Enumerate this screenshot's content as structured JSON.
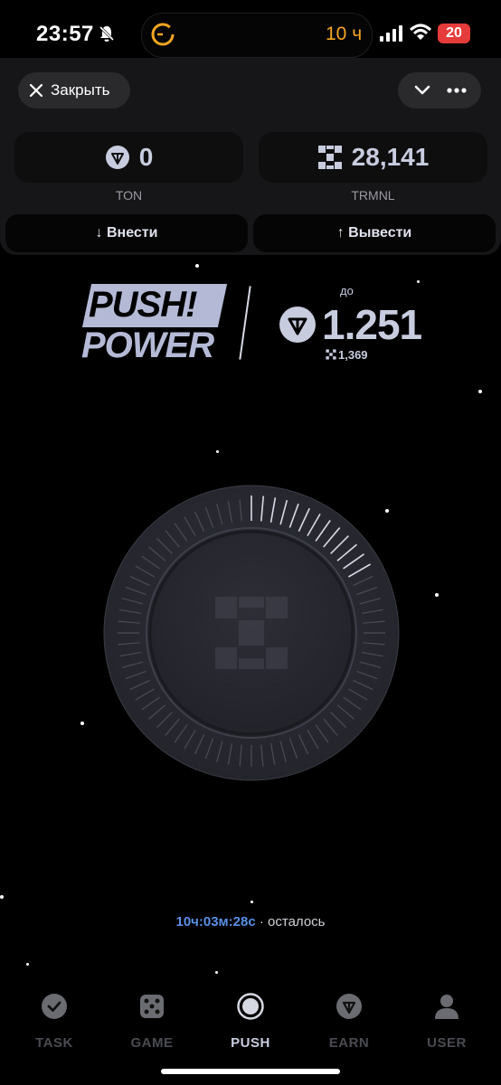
{
  "status_bar": {
    "time": "23:57",
    "island_text": "10 ч",
    "battery": "20",
    "icons": [
      "bell-slash-icon",
      "signal-icon",
      "wifi-icon",
      "battery-icon"
    ]
  },
  "header": {
    "close_label": "Закрыть",
    "close_icon": "close-icon",
    "chevron_icon": "chevron-down-icon",
    "more_icon": "more-icon"
  },
  "balances": {
    "ton": {
      "value": "0",
      "label": "TON",
      "icon": "ton-icon"
    },
    "trmnl": {
      "value": "28,141",
      "label": "TRMNL",
      "icon": "trmnl-icon"
    }
  },
  "actions": {
    "deposit": "↓ Внести",
    "withdraw": "↑ Вывести"
  },
  "promo": {
    "logo_line1": "PUSH!",
    "logo_line2": "POWER",
    "upto": "до",
    "prize_value": "1.251",
    "prize_sub": "1,369",
    "icon": "ton-icon"
  },
  "dial": {
    "icon": "trmnl-logo-icon"
  },
  "timer": {
    "value": "10ч:03м:28с",
    "suffix": "· осталось"
  },
  "nav": {
    "items": [
      {
        "label": "TASK",
        "icon": "check-circle-icon",
        "active": false
      },
      {
        "label": "GAME",
        "icon": "dice-icon",
        "active": false
      },
      {
        "label": "PUSH",
        "icon": "push-circle-icon",
        "active": true
      },
      {
        "label": "EARN",
        "icon": "ton-icon",
        "active": false
      },
      {
        "label": "USER",
        "icon": "user-icon",
        "active": false
      }
    ]
  },
  "colors": {
    "accent": "#5a8fe6",
    "island_text": "#f5a623",
    "battery": "#e63b3b",
    "logo": "#b4bad6"
  }
}
